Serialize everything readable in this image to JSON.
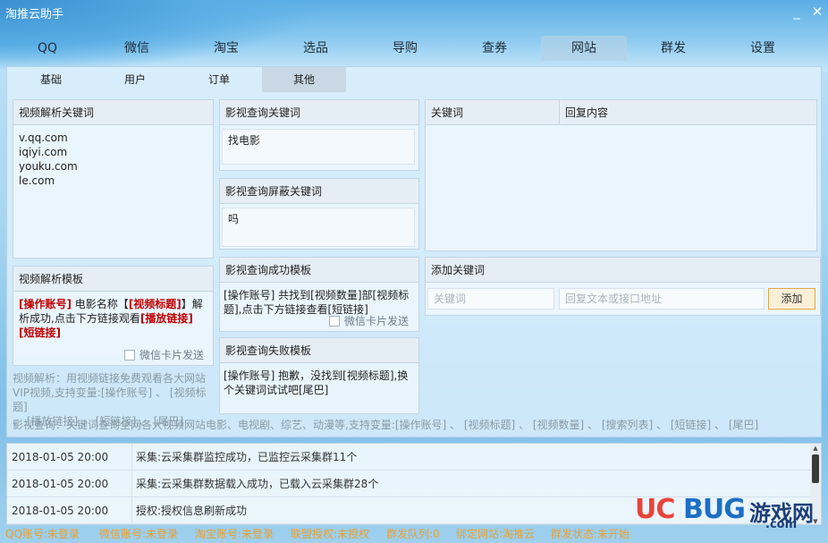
{
  "window": {
    "title": "淘推云助手",
    "minimize": "_",
    "close": "✕"
  },
  "main_tabs": [
    "QQ",
    "微信",
    "淘宝",
    "选品",
    "导购",
    "查券",
    "网站",
    "群发",
    "设置"
  ],
  "sub_tabs": [
    "基础",
    "用户",
    "订单",
    "其他"
  ],
  "video_keywords": {
    "header": "视频解析关键词",
    "items": [
      "v.qq.com",
      "iqiyi.com",
      "youku.com",
      "le.com"
    ]
  },
  "video_template": {
    "header": "视频解析模板",
    "parts": [
      "[操作账号]",
      " 电影名称【",
      "[视频标题]",
      "】解析成功,点击下方链接观看",
      "[播放链接]",
      "[短链接]"
    ],
    "checkbox_label": "微信卡片发送"
  },
  "video_hint": {
    "lines": [
      "视频解析：用视频链接免费观看各大网站",
      "VIP视频,支持变量:[操作账号] 、 [视频标题]",
      "、 [播放链接] 、 [短链接] 、 [尾巴]"
    ]
  },
  "movie_query": {
    "keyword_header": "影视查询关键词",
    "keyword_value": "找电影",
    "block_header": "影视查询屏蔽关键词",
    "block_value": "吗",
    "success_header": "影视查询成功模板",
    "success_lines": [
      "[操作账号] 共找到[视频数量]部[视频标",
      "题],点击下方链接查看[短链接]"
    ],
    "success_checkbox": "微信卡片发送",
    "fail_header": "影视查询失败模板",
    "fail_lines": [
      "[操作账号] 抱歉，没找到[视频标题],换",
      "个关键词试试吧[尾巴]"
    ]
  },
  "movie_hint": "影视查询：关键词查询全网各大视频网站电影、电视剧、综艺、动漫等,支持变量:[操作账号] 、 [视频标题] 、 [视频数量] 、 [搜索列表] 、 [短链接] 、 [尾巴]",
  "reply_table": {
    "col_keyword": "关键词",
    "col_reply": "回复内容"
  },
  "add_keyword": {
    "header": "添加关键词",
    "keyword_placeholder": "关键词",
    "reply_placeholder": "回复文本或接口地址",
    "button": "添加"
  },
  "log": [
    {
      "time": "2018-01-05 20:00",
      "msg": "采集:云采集群监控成功，已监控云采集群11个"
    },
    {
      "time": "2018-01-05 20:00",
      "msg": "采集:云采集群数据载入成功，已载入云采集群28个"
    },
    {
      "time": "2018-01-05 20:00",
      "msg": "授权:授权信息刷新成功"
    }
  ],
  "status_bar": [
    "QQ账号:未登录",
    "微信账号:未登录",
    "淘宝账号:未登录",
    "联盟授权:未授权",
    "群发队列:0",
    "绑定网站:淘推云",
    "群发状态:未开始"
  ],
  "watermark": {
    "uc": "UC",
    "bug": "BUG",
    "cn": "游戏网",
    "com": ".com"
  }
}
